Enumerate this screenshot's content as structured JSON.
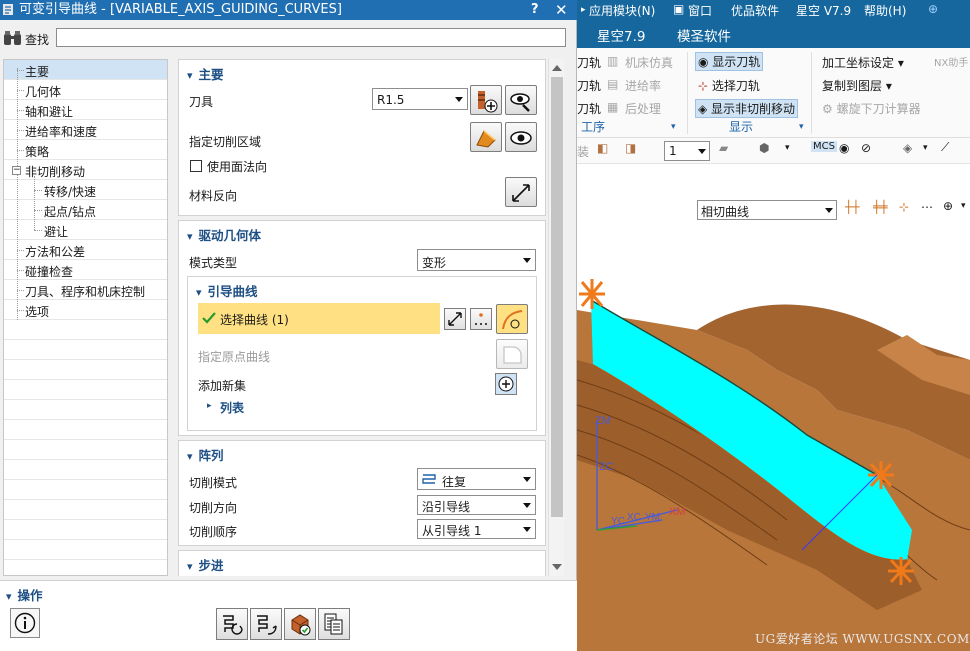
{
  "dialog": {
    "title": "可变引导曲线 - [VARIABLE_AXIS_GUIDING_CURVES]",
    "help": "?",
    "close": "✕",
    "finder_label": "查找",
    "finder_value": ""
  },
  "nav": {
    "items": [
      {
        "label": "主要",
        "selected": true
      },
      {
        "label": "几何体"
      },
      {
        "label": "轴和避让"
      },
      {
        "label": "进给率和速度"
      },
      {
        "label": "策略"
      },
      {
        "label": "非切削移动",
        "expanded": true
      },
      {
        "label": "转移/快速"
      },
      {
        "label": "起点/钻点"
      },
      {
        "label": "避让"
      },
      {
        "label": "方法和公差"
      },
      {
        "label": "碰撞检查"
      },
      {
        "label": "刀具、程序和机床控制"
      },
      {
        "label": "选项"
      }
    ]
  },
  "main": {
    "header": "主要",
    "tool_label": "刀具",
    "tool_value": "R1.5",
    "cut_area_label": "指定切削区域",
    "normal_label": "使用面法向",
    "normal_checked": false,
    "reverse_label": "材料反向"
  },
  "drive": {
    "header": "驱动几何体",
    "mode_label": "模式类型",
    "mode_value": "变形",
    "guide": {
      "header": "引导曲线",
      "select_label": "选择曲线 (1)",
      "origin_label": "指定原点曲线",
      "add_label": "添加新集",
      "list_label": "列表"
    }
  },
  "array": {
    "header": "阵列",
    "cut_mode_label": "切削模式",
    "cut_mode_value": "往复",
    "cut_dir_label": "切削方向",
    "cut_dir_value": "沿引导线",
    "cut_order_label": "切削顺序",
    "cut_order_value": "从引导线 1"
  },
  "step": {
    "header": "步进"
  },
  "operations": {
    "header": "操作"
  },
  "host": {
    "menu": [
      "应用模块(N)",
      "窗口",
      "优品软件",
      "星空 V7.9",
      "帮助(H)"
    ],
    "tabs": [
      "星空7.9",
      "模圣软件"
    ],
    "ribbon_col1": [
      "刀轨",
      "刀轨",
      "刀轨"
    ],
    "ribbon_col2": [
      "机床仿真",
      "进给率",
      "后处理"
    ],
    "ribbon_col3": [
      "显示刀轨",
      "选择刀轨",
      "显示非切削移动"
    ],
    "ribbon_col4": [
      "加工坐标设定",
      "复制到图层",
      "螺旋下刀计算器"
    ],
    "ribbon_extra": "NX助手",
    "group_labels": [
      "工序",
      "显示"
    ],
    "qbar_left": "装",
    "qbar_value": "1",
    "filter_value": "相切曲线",
    "axis_labels": [
      "ZM",
      "ZC",
      "YC",
      "XC",
      "YM",
      "XM"
    ],
    "watermark": "UG爱好者论坛 WWW.UGSNX.COM"
  },
  "colors": {
    "title_bar": "#1f6fb2",
    "host_bar": "#16679e",
    "header_text": "#1e4f84",
    "selection": "#ffe082",
    "toolpath": "#00ffff",
    "part": "#b8763b"
  }
}
